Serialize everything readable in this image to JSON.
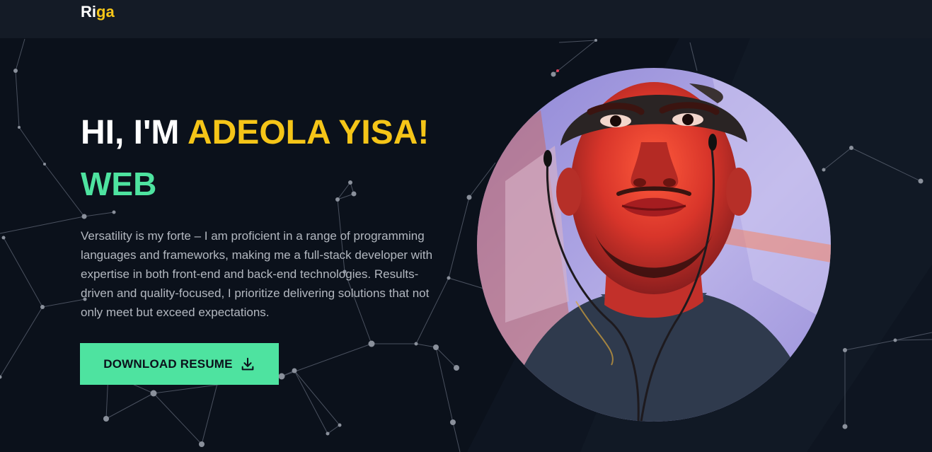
{
  "navbar": {
    "logo_part1": "Ri",
    "logo_part2": "ga"
  },
  "hero": {
    "greeting": "HI, I'M ",
    "name": "ADEOLA YISA!",
    "role": "WEB",
    "bio": "Versatility is my forte – I am proficient in a range of programming languages and frameworks, making me a full-stack developer with expertise in both front-end and back-end technologies. Results-driven and quality-focused, I prioritize delivering solutions that not only meet but exceed expectations.",
    "download_label": "DOWNLOAD RESUME",
    "download_icon": "download-icon",
    "profile_image": "profile-photo"
  },
  "colors": {
    "background": "#0b111b",
    "navbar": "#141b26",
    "accent_yellow": "#f5c518",
    "accent_green": "#4ee3a0",
    "body_text": "#b3b8c0"
  }
}
